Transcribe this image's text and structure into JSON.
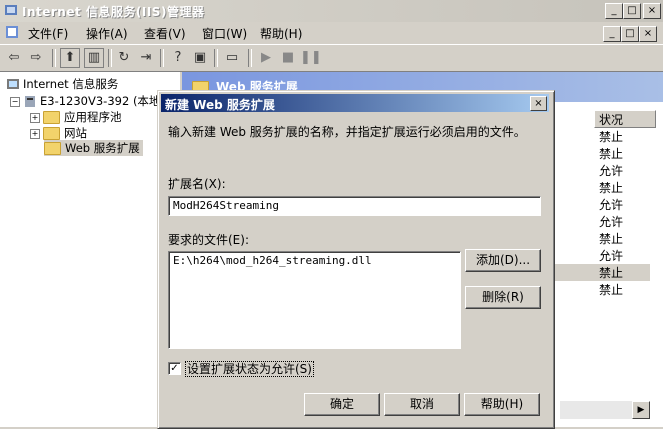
{
  "window": {
    "title": "Internet 信息服务(IIS)管理器",
    "min": "_",
    "max": "□",
    "close": "×"
  },
  "menu": {
    "items": [
      "文件(F)",
      "操作(A)",
      "查看(V)",
      "窗口(W)",
      "帮助(H)"
    ],
    "child_controls": [
      "_",
      "□",
      "×"
    ]
  },
  "tree": {
    "root": "Internet 信息服务",
    "server": "E3-1230V3-392 (本地",
    "children": [
      "应用程序池",
      "网站",
      "Web 服务扩展"
    ]
  },
  "right_pane": {
    "header_title": "Web 服务扩展",
    "status_header": "状况",
    "statuses": [
      "禁止",
      "禁止",
      "允许",
      "禁止",
      "允许",
      "允许",
      "禁止",
      "允许",
      "禁止",
      "禁止"
    ]
  },
  "dialog": {
    "title": "新建 Web 服务扩展",
    "close": "×",
    "instruction": "输入新建 Web 服务扩展的名称，并指定扩展运行必须启用的文件。",
    "ext_name_label": "扩展名(X):",
    "ext_name_value": "ModH264Streaming",
    "files_label": "要求的文件(E):",
    "files": [
      "E:\\h264\\mod_h264_streaming.dll"
    ],
    "add_button": "添加(D)...",
    "remove_button": "删除(R)",
    "allow_checkbox_label": "设置扩展状态为允许(S)",
    "allow_checked": "✓",
    "ok_button": "确定",
    "cancel_button": "取消",
    "help_button": "帮助(H)"
  }
}
